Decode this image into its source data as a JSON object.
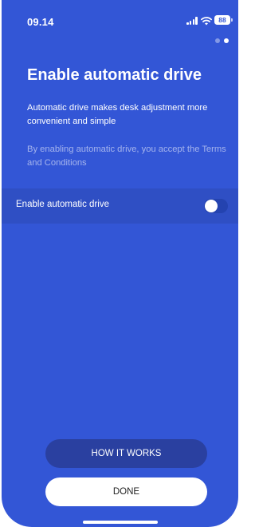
{
  "status_bar": {
    "time": "09.14",
    "battery": "88"
  },
  "pager": {
    "total": 2,
    "active_index": 1
  },
  "header": {
    "title": "Enable automatic drive",
    "description": "Automatic drive makes desk adjustment more convenient and simple",
    "terms": "By enabling automatic drive, you accept the Terms and Conditions"
  },
  "setting": {
    "label": "Enable automatic drive",
    "enabled": false
  },
  "buttons": {
    "how_it_works": "HOW IT WORKS",
    "done": "DONE"
  },
  "colors": {
    "background": "#3356d6",
    "setting_row": "#2f4fc4",
    "secondary_button": "#2a40a0",
    "primary_button": "#ffffff"
  }
}
